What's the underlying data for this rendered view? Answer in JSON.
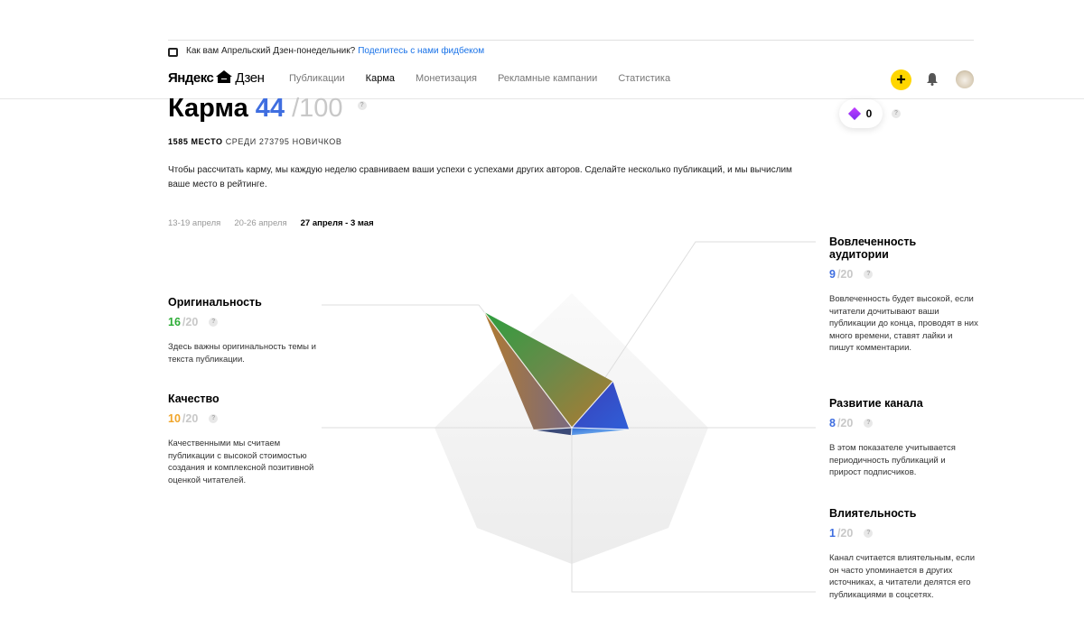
{
  "banner": {
    "text": "Как вам Апрельский Дзен-понедельник?",
    "link": "Поделитесь с нами фидбеком"
  },
  "header": {
    "logo_main": "Яндекс",
    "logo_zen": "Дзен",
    "nav": [
      {
        "label": "Публикации",
        "active": false
      },
      {
        "label": "Карма",
        "active": true
      },
      {
        "label": "Монетизация",
        "active": false
      },
      {
        "label": "Рекламные кампании",
        "active": false
      },
      {
        "label": "Статистика",
        "active": false
      }
    ],
    "plus_label": "+"
  },
  "karma": {
    "title": "Карма",
    "score": "44",
    "max": "/100",
    "rank_place": "1585 МЕСТО",
    "rank_rest": "СРЕДИ 273795 НОВИЧКОВ",
    "description": "Чтобы рассчитать карму, мы каждую неделю сравниваем ваши успехи с успехами других авторов. Сделайте несколько публикаций, и мы вычислим ваше место в рейтинге.",
    "diamonds": "0",
    "help": "?"
  },
  "weeks": [
    {
      "label": "13-19 апреля",
      "active": false
    },
    {
      "label": "20-26 апреля",
      "active": false
    },
    {
      "label": "27 апреля - 3 мая",
      "active": true
    }
  ],
  "metrics": {
    "originality": {
      "name": "Оригинальность",
      "value": "16",
      "max": "/20",
      "color": "#2dac36",
      "text": "Здесь важны оригинальность темы и текста публикации."
    },
    "quality": {
      "name": "Качество",
      "value": "10",
      "max": "/20",
      "color": "#f0a52a",
      "text": "Качественными мы считаем публикации с высокой стоимостью создания и комплексной позитивной оценкой читателей."
    },
    "engagement": {
      "name": "Вовлеченность аудитории",
      "value": "9",
      "max": "/20",
      "color": "#3f6ee0",
      "text": "Вовлеченность будет высокой, если читатели дочитывают ваши публикации до конца, проводят в них много времени, ставят лайки и пишут комментарии."
    },
    "growth": {
      "name": "Развитие канала",
      "value": "8",
      "max": "/20",
      "color": "#3f6ee0",
      "text": "В этом показателе учитывается периодичность публикаций и прирост подписчиков."
    },
    "influence": {
      "name": "Влиятельность",
      "value": "1",
      "max": "/20",
      "color": "#3f6ee0",
      "text": "Канал считается влиятельным, если он часто упоминается в других источниках, а читатели делятся его публикациями в соцсетях."
    }
  },
  "radar": {
    "max": 20,
    "axes": [
      "originality",
      "engagement",
      "growth",
      "influence",
      "quality"
    ],
    "values": [
      16,
      9,
      8,
      1,
      10
    ]
  }
}
